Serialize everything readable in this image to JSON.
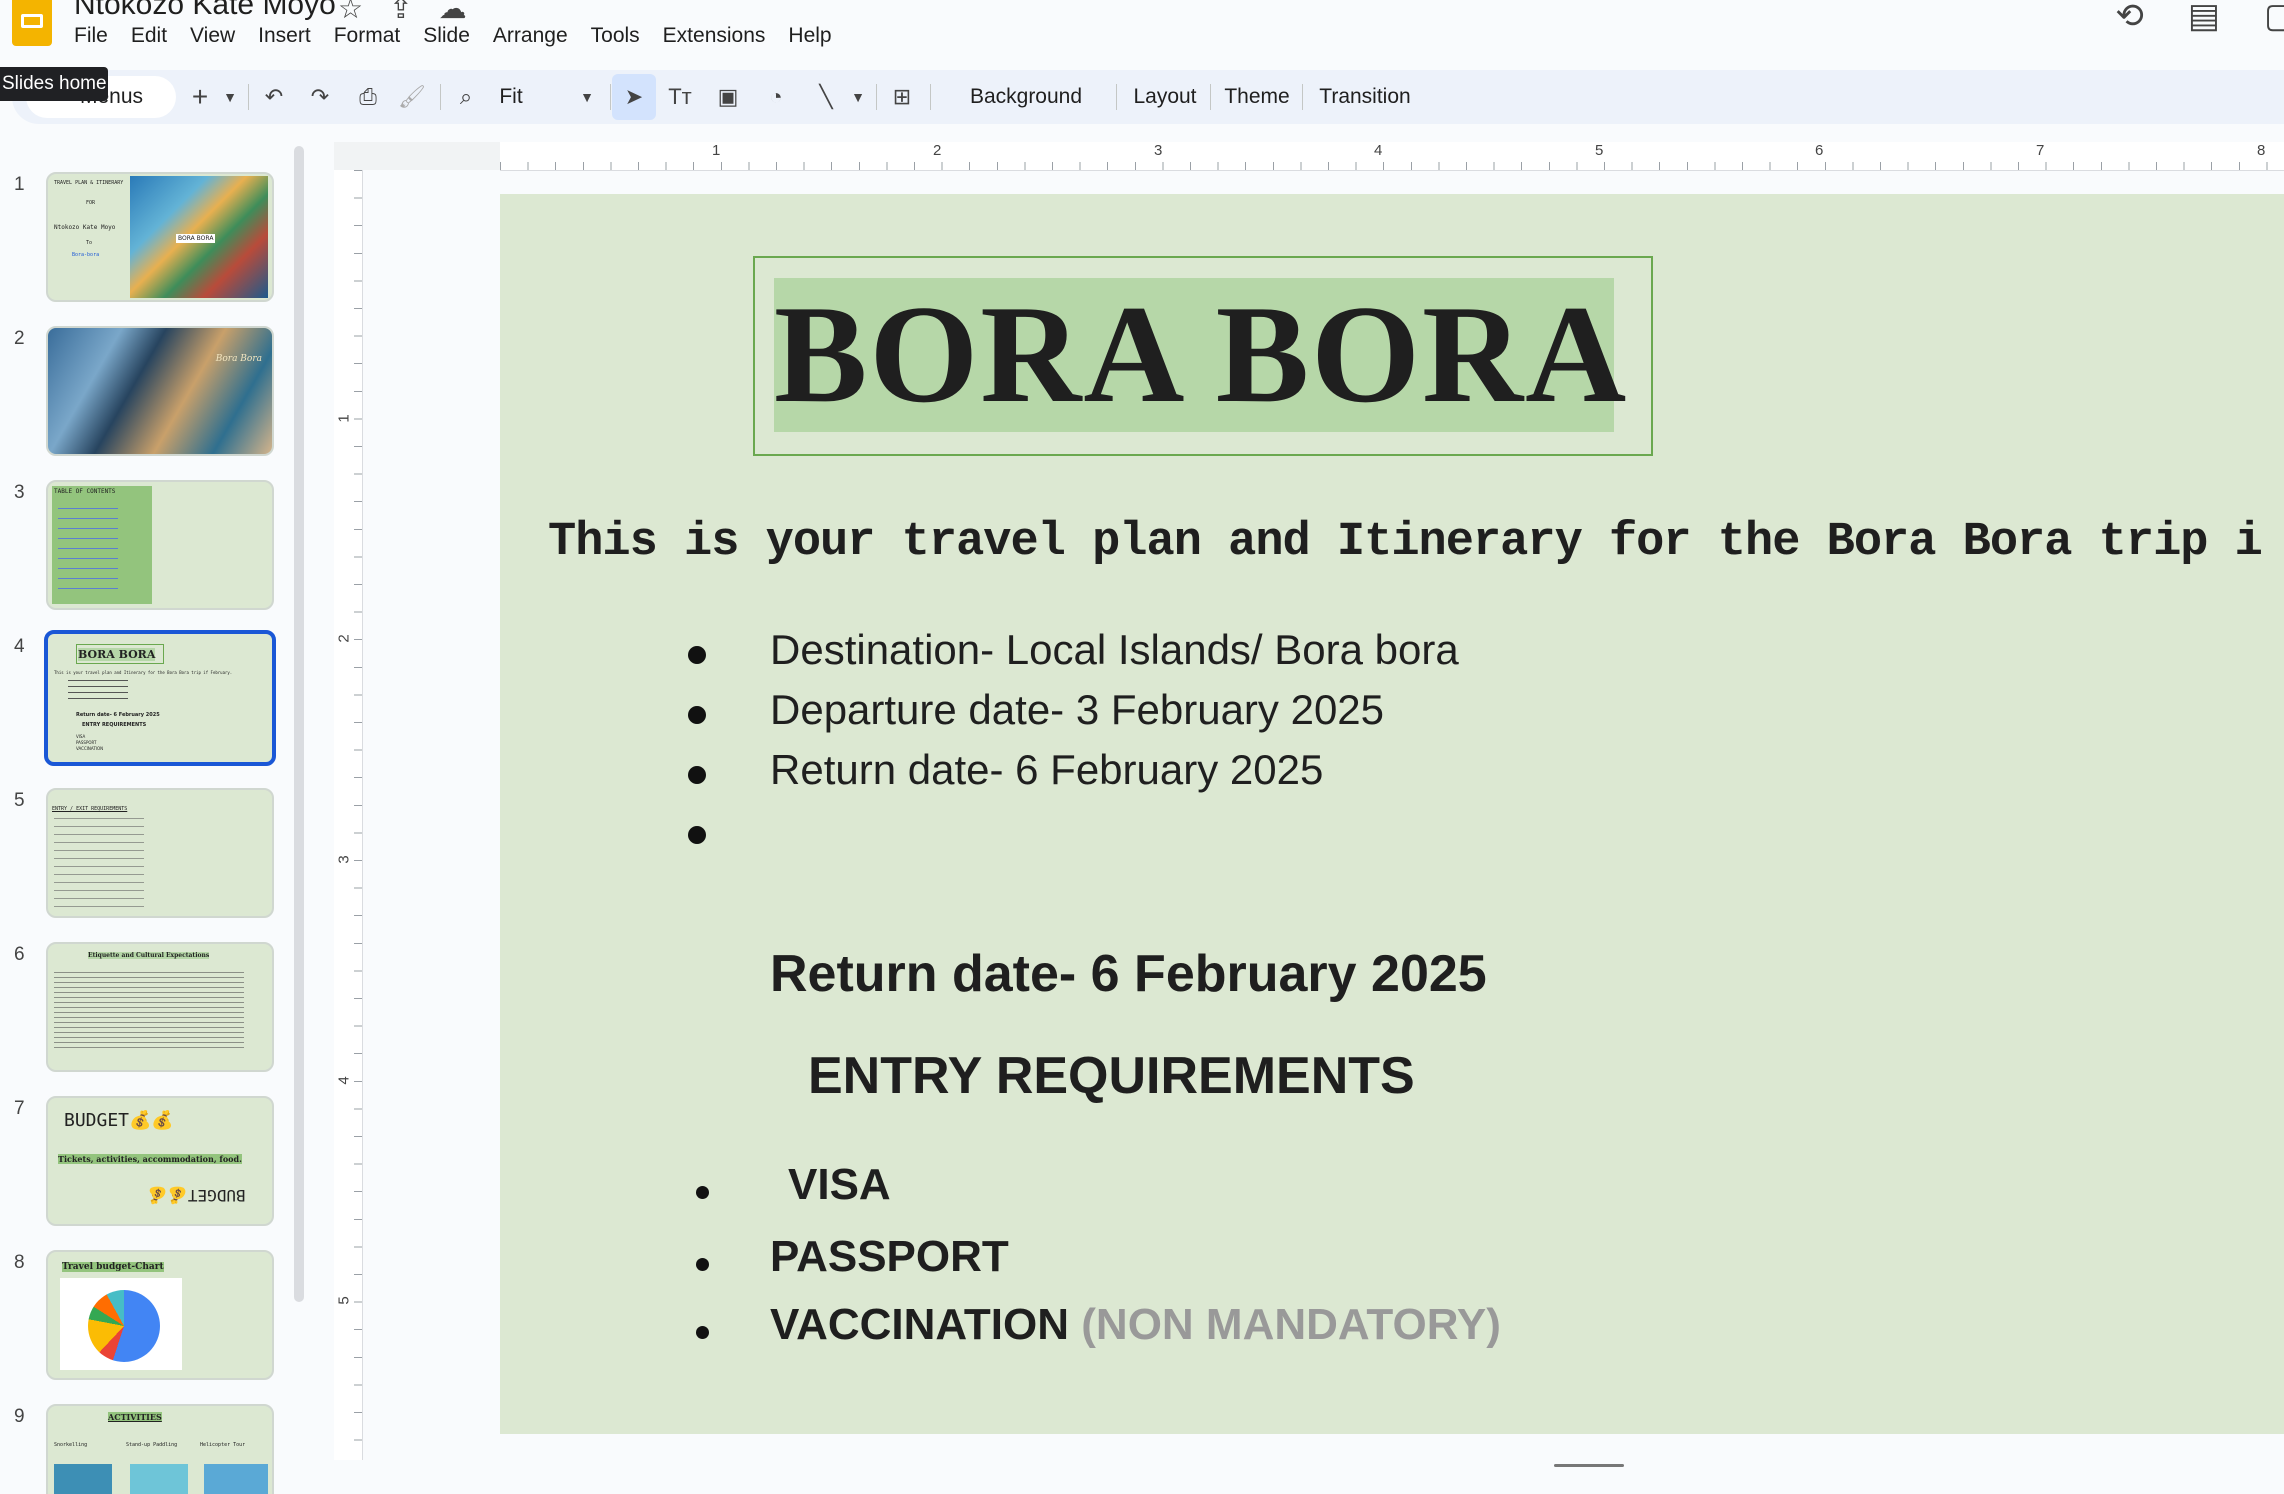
{
  "app": {
    "doc_title": "Ntokozo Kate Moyo",
    "menu": [
      "File",
      "Edit",
      "View",
      "Insert",
      "Format",
      "Slide",
      "Arrange",
      "Tools",
      "Extensions",
      "Help"
    ]
  },
  "toolbar": {
    "menus_label": "Menus",
    "tooltip": "Slides home",
    "zoom": "Fit",
    "buttons": [
      "Background",
      "Layout",
      "Theme",
      "Transition"
    ]
  },
  "ruler": {
    "horizontal": [
      "1",
      "2",
      "3",
      "4",
      "5",
      "6",
      "7",
      "8"
    ],
    "vertical": [
      "1",
      "2",
      "3",
      "4",
      "5"
    ]
  },
  "filmstrip": {
    "numbers": [
      "1",
      "2",
      "3",
      "4",
      "5",
      "6",
      "7",
      "8",
      "9"
    ],
    "thumbs": {
      "s1": [
        "TRAVEL PLAN & ITINERARY",
        "FOR",
        "Ntokozo Kate Moyo",
        "To",
        "Bora-bora",
        "BORA BORA"
      ],
      "s2": [
        "Bora Bora"
      ],
      "s3": [
        "TABLE OF CONTENTS"
      ],
      "s4": [
        "BORA BORA",
        "This is your travel plan and Itinerary for the Bora Bora trip if February.",
        "Return date- 6 February 2025",
        "ENTRY REQUIREMENTS",
        "VISA",
        "PASSPORT",
        "VACCINATION"
      ],
      "s5": [
        "ENTRY / EXIT REQUIREMENTS"
      ],
      "s6": [
        "Etiquette and Cultural Expectations"
      ],
      "s7": [
        "BUDGET💰💰",
        "Tickets, activities, accommodation, food.",
        "BUDGET💰💰"
      ],
      "s8": [
        "Travel budget-Chart"
      ],
      "s9": [
        "ACTIVITIES",
        "Snorkelling",
        "Stand-up Paddling",
        "Helicopter Tour"
      ]
    }
  },
  "slide": {
    "title": "BORA BORA",
    "subtitle": "This is your travel plan and Itinerary for the Bora Bora trip i",
    "bullets": [
      "Destination- Local Islands/ Bora bora",
      "Departure date- 3 February 2025",
      "Return date- 6 February 2025",
      ""
    ],
    "return_heading": "Return date- 6 February 2025",
    "entry_heading": "ENTRY REQUIREMENTS",
    "requirements": [
      "VISA",
      "PASSPORT",
      "VACCINATION"
    ],
    "vaccination_note": "(NON MANDATORY)"
  },
  "colors": {
    "slide_bg": "#dce8d2",
    "title_highlight": "#b6d7a8",
    "title_border": "#6aa84f",
    "selection": "#1a57d6",
    "toolbar_bg": "#edf2fa"
  }
}
